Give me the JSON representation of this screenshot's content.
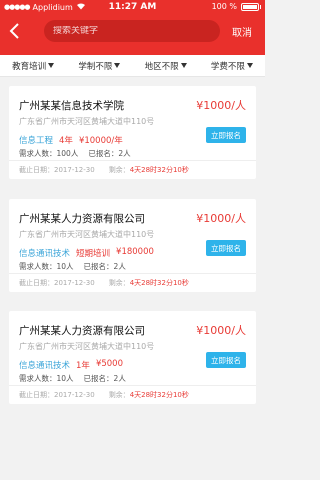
{
  "status_bar": {
    "carrier": "Applidium",
    "time": "11:27 AM",
    "battery": "100 %"
  },
  "header": {
    "search_placeholder": "搜索关键字",
    "cancel_label": "取消"
  },
  "filters": [
    {
      "label": "教育培训"
    },
    {
      "label": "学制不限"
    },
    {
      "label": "地区不限"
    },
    {
      "label": "学费不限"
    }
  ],
  "cards": [
    {
      "name": "广州某某信息技术学院",
      "price": "¥1000/人",
      "address": "广东省广州市天河区黄埔大道中110号",
      "category": "信息工程",
      "duration": "4年",
      "fee": "¥10000/年",
      "enrolled": "需求人数：100人",
      "registered": "已报名：2人",
      "deadline": "截止日期：2017-12-30",
      "remaining_label": "剩余：",
      "countdown": "4天28时32分10秒",
      "button_label": "立即报名"
    },
    {
      "name": "广州某某人力资源有限公司",
      "price": "¥1000/人",
      "address": "广东省广州市天河区黄埔大道中110号",
      "category": "信息通讯技术",
      "duration": "短期培训",
      "fee": "¥180000",
      "enrolled": "需求人数：10人",
      "registered": "已报名：2人",
      "deadline": "截止日期：2017-12-30",
      "remaining_label": "剩余：",
      "countdown": "4天28时32分10秒",
      "button_label": "立即报名"
    },
    {
      "name": "广州某某人力资源有限公司",
      "price": "¥1000/人",
      "address": "广东省广州市天河区黄埔大道中110号",
      "category": "信息通讯技术",
      "duration": "1年",
      "fee": "¥5000",
      "enrolled": "需求人数：10人",
      "registered": "已报名：2人",
      "deadline": "截止日期：2017-12-30",
      "remaining_label": "剩余：",
      "countdown": "4天28时32分10秒",
      "button_label": "立即报名"
    }
  ]
}
